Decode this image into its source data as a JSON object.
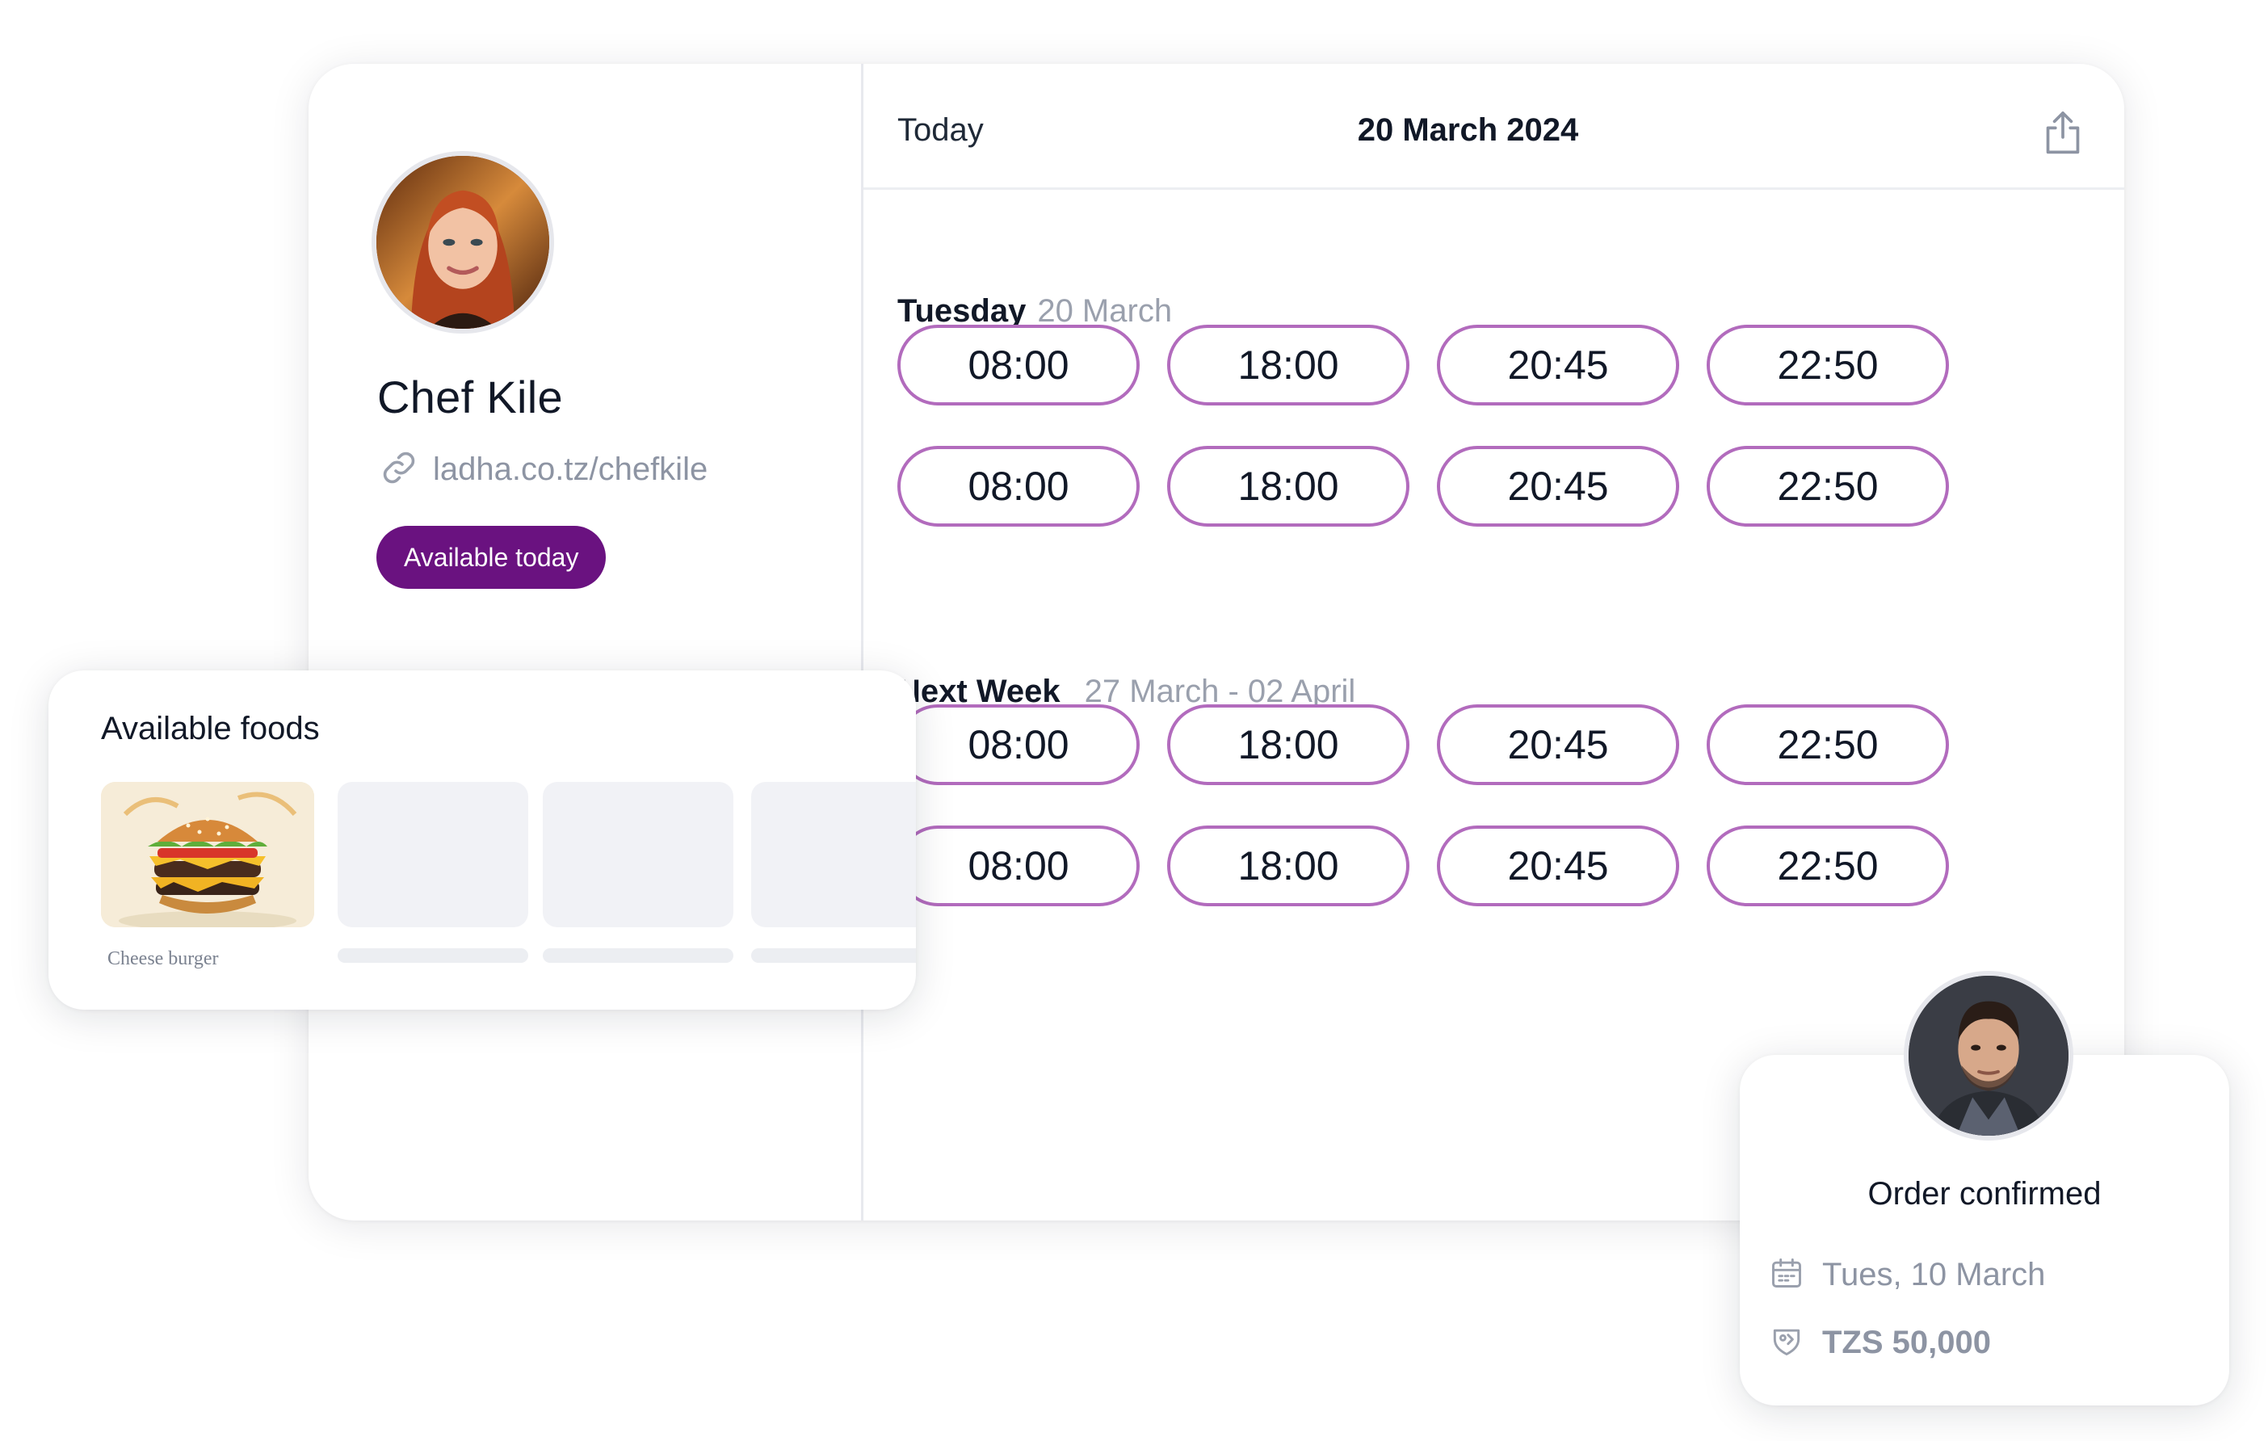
{
  "profile": {
    "name": "Chef Kile",
    "link": "ladha.co.tz/chefkile",
    "badge": "Available today"
  },
  "header": {
    "today_label": "Today",
    "date": "20 March 2024"
  },
  "sections": [
    {
      "day": "Tuesday",
      "date": "20 March",
      "rows": [
        [
          "08:00",
          "18:00",
          "20:45",
          "22:50"
        ],
        [
          "08:00",
          "18:00",
          "20:45",
          "22:50"
        ]
      ]
    },
    {
      "day": "Next Week",
      "date": "27 March - 02 April",
      "rows": [
        [
          "08:00",
          "18:00",
          "20:45",
          "22:50"
        ],
        [
          "08:00",
          "18:00",
          "20:45",
          "22:50"
        ]
      ]
    }
  ],
  "foods": {
    "title": "Available foods",
    "items": [
      {
        "name": "Cheese burger"
      }
    ]
  },
  "order": {
    "title": "Order confirmed",
    "date": "Tues, 10 March",
    "price": "TZS 50,000"
  },
  "colors": {
    "accent": "#6a1280",
    "slot_border": "#b26bbd",
    "muted_text": "#8d94a3"
  },
  "icons": [
    "link-icon",
    "share-icon",
    "calendar-icon",
    "price-tag-icon"
  ]
}
